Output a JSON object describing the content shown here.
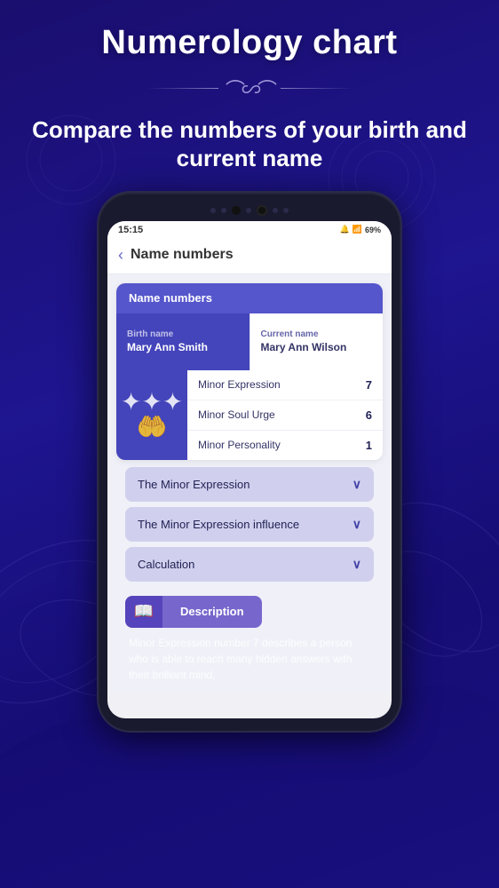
{
  "app": {
    "main_title": "Numerology chart",
    "subtitle": "Compare the numbers of your birth and current name",
    "ornament_symbol": "∿∿"
  },
  "status_bar": {
    "time": "15:15",
    "battery": "69%",
    "icons": "🔔📶"
  },
  "header": {
    "back_label": "‹",
    "title": "Name numbers"
  },
  "card": {
    "header_label": "Name numbers",
    "birth_name_label": "Birth name",
    "birth_name_value": "Mary Ann Smith",
    "current_name_label": "Current name",
    "current_name_value": "Mary Ann Wilson"
  },
  "numbers": [
    {
      "label": "Minor Expression",
      "value": "7"
    },
    {
      "label": "Minor Soul Urge",
      "value": "6"
    },
    {
      "label": "Minor Personality",
      "value": "1"
    }
  ],
  "accordion": [
    {
      "label": "The Minor Expression"
    },
    {
      "label": "The Minor Expression influence"
    },
    {
      "label": "Calculation"
    }
  ],
  "description": {
    "icon_label": "📖",
    "label": "Description",
    "text": "Minor Expression number 7 describes a person who is able to reach many hidden answers with their brilliant mind,"
  }
}
